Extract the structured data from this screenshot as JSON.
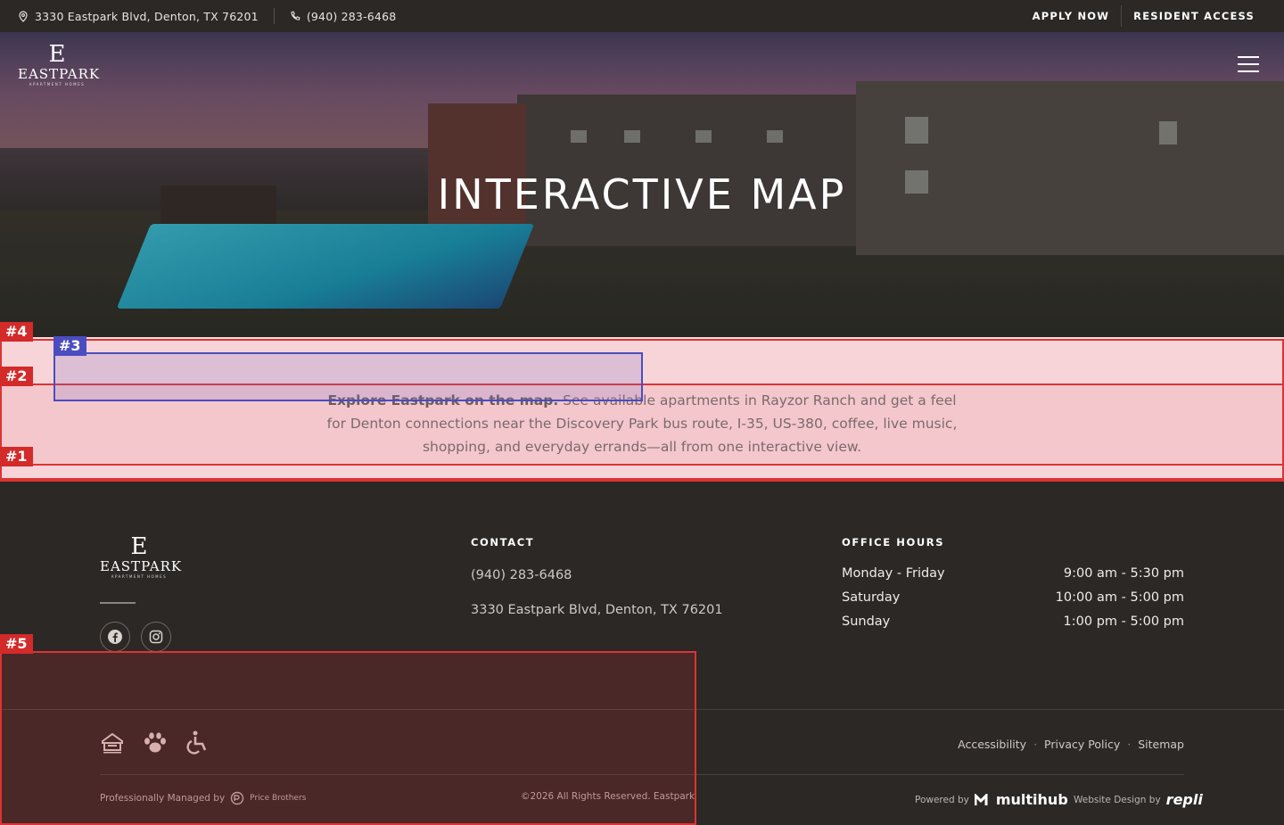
{
  "topbar": {
    "address": "3330 Eastpark Blvd, Denton, TX 76201",
    "phone": "(940) 283-6468",
    "apply_label": "APPLY NOW",
    "resident_label": "RESIDENT ACCESS"
  },
  "logo": {
    "initial": "E",
    "name": "EASTPARK",
    "tagline": "APARTMENT HOMES"
  },
  "hero": {
    "title": "INTERACTIVE MAP"
  },
  "intro": {
    "lead": "Explore Eastpark on the map.",
    "body": " See available apartments in Rayzor Ranch and get a feel for Denton connections near the Discovery Park bus route, I-35, US-380, coffee, live music, shopping, and everyday errands—all from one interactive view."
  },
  "annotations": [
    "#4",
    "#3",
    "#2",
    "#1",
    "#5"
  ],
  "footer": {
    "contact_title": "CONTACT",
    "contact_phone": "(940) 283-6468",
    "contact_address": "3330 Eastpark Blvd, Denton, TX 76201",
    "hours_title": "OFFICE HOURS",
    "hours": [
      {
        "day": "Monday - Friday",
        "time": "9:00 am - 5:30 pm"
      },
      {
        "day": "Saturday",
        "time": "10:00 am - 5:00 pm"
      },
      {
        "day": "Sunday",
        "time": "1:00 pm - 5:00 pm"
      }
    ],
    "links": [
      "Accessibility",
      "Privacy Policy",
      "Sitemap"
    ],
    "managed_by": "Professionally Managed by",
    "manager_name": "Price Brothers",
    "copyright": "©2026 All Rights Reserved. Eastpark",
    "powered_by": "Powered by",
    "powered_brand": "multihub",
    "design_by": "Website Design by",
    "design_brand": "repli"
  },
  "colors": {
    "accent_red": "#d32a2a",
    "accent_blue": "#4a4dc0",
    "footer_bg": "#2b2826",
    "intro_bg": "#f8dfe2"
  }
}
